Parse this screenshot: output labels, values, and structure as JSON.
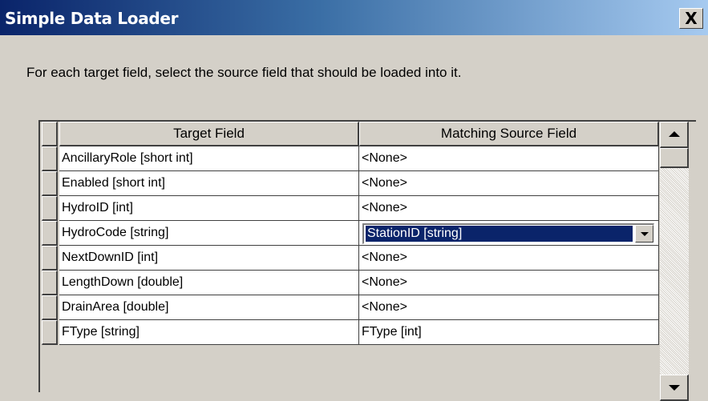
{
  "window": {
    "title": "Simple Data Loader",
    "close_label": "X"
  },
  "instruction": "For each target field, select the source field that should be loaded into it.",
  "grid": {
    "columns": [
      "Target Field",
      "Matching Source Field"
    ],
    "rows": [
      {
        "target": "AncillaryRole [short int]",
        "source": "<None>"
      },
      {
        "target": "Enabled [short int]",
        "source": "<None>"
      },
      {
        "target": "HydroID [int]",
        "source": "<None>"
      },
      {
        "target": "HydroCode [string]",
        "source": "StationID [string]",
        "editing": true
      },
      {
        "target": "NextDownID [int]",
        "source": "<None>"
      },
      {
        "target": "LengthDown [double]",
        "source": "<None>"
      },
      {
        "target": "DrainArea [double]",
        "source": "<None>"
      },
      {
        "target": "FType [string]",
        "source": "FType [int]"
      }
    ]
  },
  "colors": {
    "title_start": "#0a246a",
    "title_end": "#a6caf0",
    "face": "#d4d0c8",
    "selection": "#0a246a"
  },
  "icons": {
    "close": "close-icon",
    "dropdown": "chevron-down-icon",
    "scroll_up": "scroll-up-arrow-icon",
    "scroll_down": "scroll-down-arrow-icon"
  }
}
